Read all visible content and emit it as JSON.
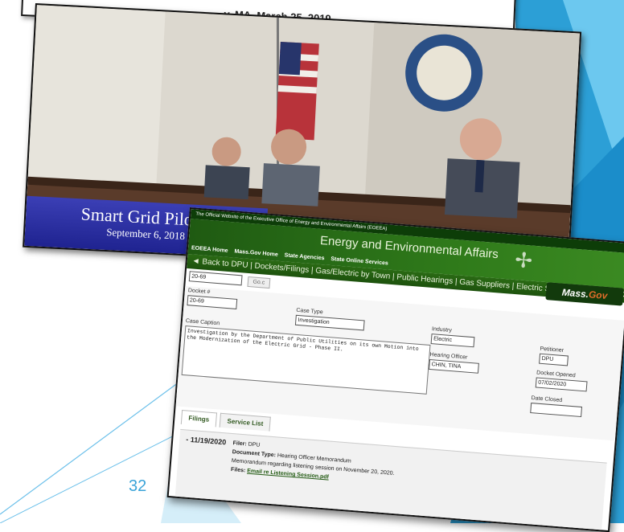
{
  "top_card": {
    "caption": "y, MA, March 25, 2019"
  },
  "photo": {
    "caption_title": "Smart Grid Pilot P",
    "caption_date": "September 6, 2018"
  },
  "eoeea": {
    "top_strip": "The Official Website of the Executive Office of Energy and Environmental Affairs (EOEEA)",
    "title": "Energy and Environmental Affairs",
    "nav": [
      "EOEEA Home",
      "Mass.Gov Home",
      "State Agencies",
      "State Online Services"
    ],
    "logo_text": "Mass.",
    "logo_suffix": "Gov",
    "breadcrumb": "◄ Back to DPU  |  Dockets/Filings  |  Gas/Electric by Town  |  Public Hearings  |  Gas Suppliers  |  Electric Suppliers  |  Licensed Carriers  |",
    "search_value": "20-69",
    "go_label": "Go.c"
  },
  "docket_form": {
    "docket_label": "Docket #",
    "docket_value": "20-69",
    "case_type_label": "Case Type",
    "case_type_value": "Investigation",
    "industry_label": "Industry",
    "industry_value": "Electric",
    "petitioner_label": "Petitioner",
    "petitioner_value": "DPU",
    "caption_label": "Case Caption",
    "caption_value": "Investigation by the Department of Public Utilities on its own Motion into the Modernization of the Electric Grid - Phase II.",
    "hearing_officer_label": "Hearing Officer",
    "hearing_officer_value": "CHIN, TINA",
    "docket_opened_label": "Docket Opened",
    "docket_opened_value": "07/02/2020",
    "date_closed_label": "Date Closed",
    "date_closed_value": ""
  },
  "tabs": [
    "Filings",
    "Service List"
  ],
  "filing": {
    "toggle": "-",
    "date": "11/19/2020",
    "filer_label": "Filer:",
    "filer_value": "DPU",
    "doctype_label": "Document Type:",
    "doctype_value": "Hearing Officer Memorandum",
    "description": "Memorandum regarding listening session on November 20, 2020.",
    "files_label": "Files:",
    "file_link": "Email re Listening Session.pdf"
  },
  "slide_number": "32",
  "colors": {
    "accent_blue": "#3aa3d8",
    "dark_green": "#1f5a12",
    "caption_blue": "#2a2ea5"
  }
}
